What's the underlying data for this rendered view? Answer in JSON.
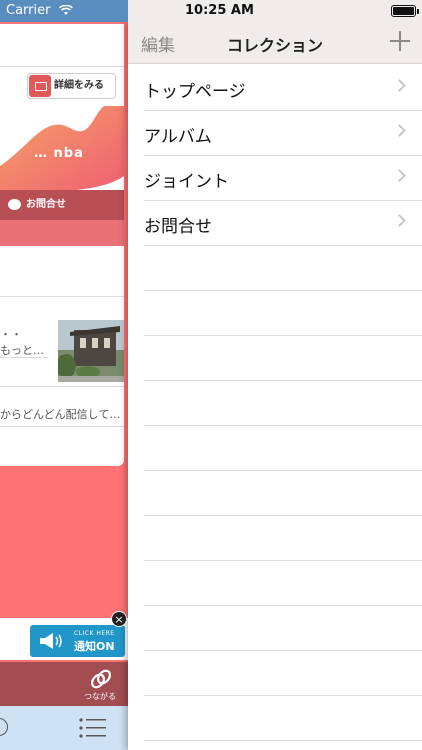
{
  "status_bar": {
    "carrier": "Carrier",
    "time": "10:25 AM"
  },
  "left_app": {
    "detail_button": "詳細をみる",
    "banner_text": "… nba",
    "contact_label": "お問合せ",
    "news_item_1_line1": "・・",
    "news_item_1_line2": "もっと…",
    "news_item_2": "からどんどん配信して…",
    "notify_small": "CLICK HERE",
    "notify_main": "通知ON",
    "link_label": "つながる",
    "colors": {
      "background": "#ff7273",
      "contact_bar": "#b74f55",
      "notify_button": "#2196c9",
      "tabbar": "#cfe2f3"
    }
  },
  "collection": {
    "edit": "編集",
    "title": "コレクション",
    "add_icon": "plus-icon",
    "items": [
      {
        "label": "トップページ"
      },
      {
        "label": "アルバム"
      },
      {
        "label": "ジョイント"
      },
      {
        "label": "お問合せ"
      }
    ]
  }
}
